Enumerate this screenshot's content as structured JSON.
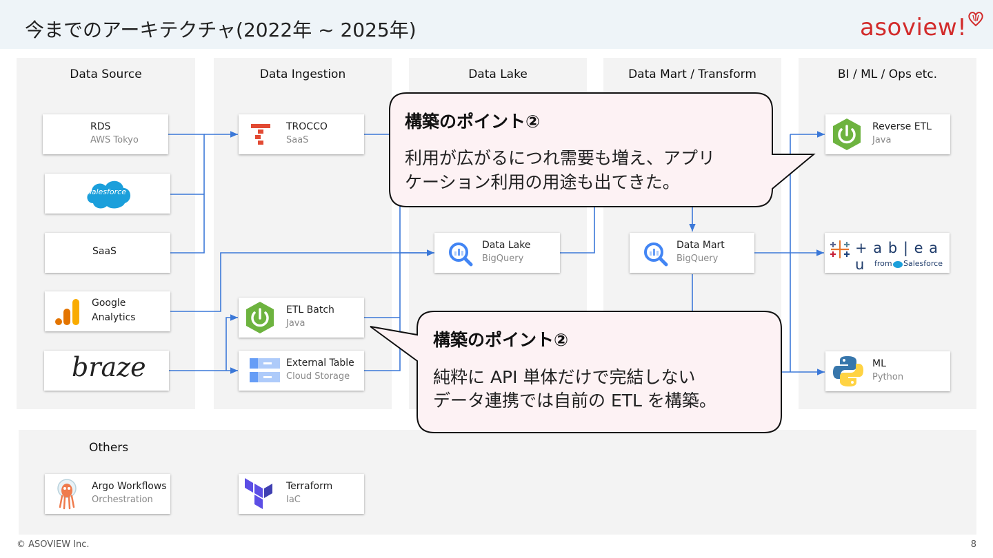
{
  "title": "今までのアーキテクチャ(2022年 ~ 2025年)",
  "logo_text": "asoview!",
  "columns": {
    "data_source": "Data Source",
    "data_ingestion": "Data Ingestion",
    "data_lake": "Data Lake",
    "data_mart": "Data Mart / Transform",
    "bi_ml_ops": "BI / ML / Ops etc."
  },
  "cards": {
    "rds": {
      "name": "RDS",
      "sub": "AWS Tokyo"
    },
    "salesforce": {
      "logo_text": "salesforce"
    },
    "saas": {
      "name": "SaaS"
    },
    "google_analytics": {
      "name": "Google",
      "name2": "Analytics"
    },
    "braze": {
      "logo_text": "braze"
    },
    "trocco": {
      "name": "TROCCO",
      "sub": "SaaS"
    },
    "etl_batch": {
      "name": "ETL Batch",
      "sub": "Java"
    },
    "external_table": {
      "name": "External Table",
      "sub": "Cloud Storage"
    },
    "data_lake": {
      "name": "Data Lake",
      "sub": "BigQuery"
    },
    "data_mart": {
      "name": "Data Mart",
      "sub": "BigQuery"
    },
    "reverse_etl": {
      "name": "Reverse ETL",
      "sub": "Java"
    },
    "tableau": {
      "logo_text": "+ a b | e a u",
      "from_text": "from",
      "sf_text": "Salesforce"
    },
    "ml": {
      "name": "ML",
      "sub": "Python"
    },
    "argo": {
      "name": "Argo Workflows",
      "sub": "Orchestration"
    },
    "terraform": {
      "name": "Terraform",
      "sub": "IaC"
    }
  },
  "others_title": "Others",
  "callout_top": {
    "title": "構築のポイント②",
    "line1": "利用が広がるにつれ需要も増え、アプリ",
    "line2": "ケーション利用の用途も出てきた。"
  },
  "callout_bottom": {
    "title": "構築のポイント②",
    "line1": "純粋に API 単体だけで完結しない",
    "line2": "データ連携では自前の  ETL を構築。"
  },
  "footer": "© ASOVIEW Inc.",
  "page_number": "8",
  "colors": {
    "line": "#3b78d8",
    "callout_fill": "#fdf2f4",
    "logo": "#d22b2b",
    "column_bg": "#f3f3f3"
  }
}
